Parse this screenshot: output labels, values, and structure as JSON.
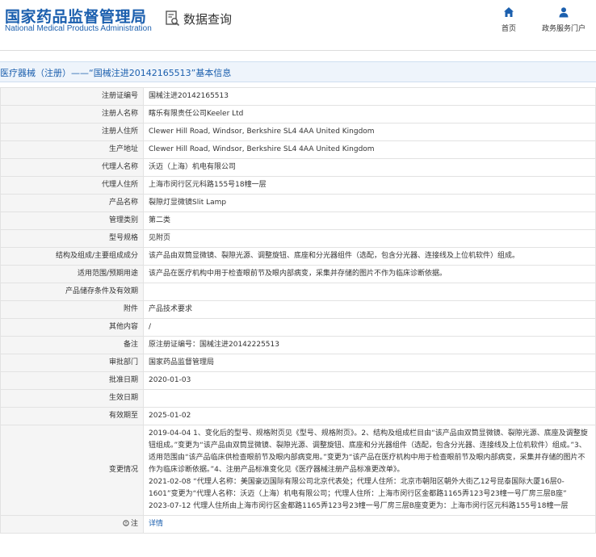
{
  "header": {
    "logo_cn": "国家药品监督管理局",
    "logo_en": "National Medical Products Administration",
    "query_label": "数据查询",
    "nav": [
      {
        "label": "首页",
        "icon": "home-icon"
      },
      {
        "label": "政务服务门户",
        "icon": "user-icon"
      }
    ]
  },
  "page_title": "医疗器械（注册）——“国械注进20142165513”基本信息",
  "rows": [
    {
      "label": "注册证编号",
      "value": "国械注进20142165513"
    },
    {
      "label": "注册人名称",
      "value": "瞎乐有限责任公司Keeler Ltd"
    },
    {
      "label": "注册人住所",
      "value": "Clewer Hill Road, Windsor, Berkshire SL4 4AA United Kingdom"
    },
    {
      "label": "生产地址",
      "value": "Clewer Hill Road, Windsor, Berkshire SL4 4AA United Kingdom"
    },
    {
      "label": "代理人名称",
      "value": "沃迈（上海）机电有限公司"
    },
    {
      "label": "代理人住所",
      "value": "上海市闵行区元科路155号18幢一层"
    },
    {
      "label": "产品名称",
      "value": "裂隙灯显微镜Slit Lamp"
    },
    {
      "label": "管理类别",
      "value": "第二类"
    },
    {
      "label": "型号规格",
      "value": "见附页"
    },
    {
      "label": "结构及组成/主要组成成分",
      "value": "该产品由双筒显微镜、裂隙光源、调整旋钮、底座和分光器组件（选配，包含分光器、连接线及上位机软件）组成。"
    },
    {
      "label": "适用范围/预期用途",
      "value": "该产品在医疗机构中用于检查眼前节及眼内部病变，采集并存储的图片不作为临床诊断依据。"
    },
    {
      "label": "产品储存条件及有效期",
      "value": ""
    },
    {
      "label": "附件",
      "value": "产品技术要求"
    },
    {
      "label": "其他内容",
      "value": "/"
    },
    {
      "label": "备注",
      "value": "原注册证编号：国械注进20142225513"
    },
    {
      "label": "审批部门",
      "value": "国家药品监督管理局"
    },
    {
      "label": "批准日期",
      "value": "2020-01-03"
    },
    {
      "label": "生效日期",
      "value": ""
    },
    {
      "label": "有效期至",
      "value": "2025-01-02"
    },
    {
      "label": "变更情况",
      "value": "2019-04-04 1、变化后的型号、规格附页见《型号、规格附页》。2、结构及组成栏目由“该产品由双筒显微镜、裂隙光源、底座及调整旋钮组成。”变更为“该产品由双筒显微镜、裂隙光源、调整旋钮、底座和分光器组件（选配，包含分光器、连接线及上位机软件）组成。”3、适用范围由“该产品临床供检查眼前节及眼内部病变用。”变更为“该产品在医疗机构中用于检查眼前节及眼内部病变，采集并存储的图片不作为临床诊断依据。”4、注册产品标准变化见《医疗器械注册产品标准更改单》。\n2021-02-08 “代理人名称：美国豪迈国际有限公司北京代表处；代理人住所：北京市朝阳区朝外大街乙12号昆泰国际大厦16层0-1601”变更为“代理人名称：沃迈（上海）机电有限公司；代理人住所：上海市闵行区金都路1165弄123号23幢一号厂房三层B座”\n2023-07-12 代理人住所由上海市闵行区金都路1165弄123号23幢一号厂房三层B座变更为：上海市闵行区元科路155号18幢一层"
    },
    {
      "label": "注",
      "value": "详情",
      "link": true,
      "icon": "note-icon"
    }
  ]
}
